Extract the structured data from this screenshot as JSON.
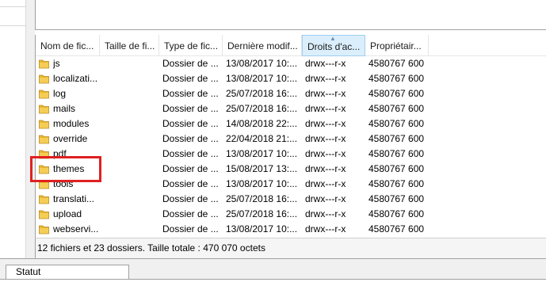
{
  "columns": [
    {
      "key": "name",
      "label": "Nom de fic..."
    },
    {
      "key": "size",
      "label": "Taille de fi..."
    },
    {
      "key": "type",
      "label": "Type de fic..."
    },
    {
      "key": "modified",
      "label": "Dernière modif..."
    },
    {
      "key": "perms",
      "label": "Droits d'ac..."
    },
    {
      "key": "owner",
      "label": "Propriétair..."
    }
  ],
  "rows": [
    {
      "name": "js",
      "type": "Dossier de ...",
      "modified": "13/08/2017 10:...",
      "perms": "drwx---r-x",
      "owner": "4580767 600"
    },
    {
      "name": "localizati...",
      "type": "Dossier de ...",
      "modified": "13/08/2017 10:...",
      "perms": "drwx---r-x",
      "owner": "4580767 600"
    },
    {
      "name": "log",
      "type": "Dossier de ...",
      "modified": "25/07/2018 16:...",
      "perms": "drwx---r-x",
      "owner": "4580767 600"
    },
    {
      "name": "mails",
      "type": "Dossier de ...",
      "modified": "25/07/2018 16:...",
      "perms": "drwx---r-x",
      "owner": "4580767 600"
    },
    {
      "name": "modules",
      "type": "Dossier de ...",
      "modified": "14/08/2018 22:...",
      "perms": "drwx---r-x",
      "owner": "4580767 600"
    },
    {
      "name": "override",
      "type": "Dossier de ...",
      "modified": "22/04/2018 21:...",
      "perms": "drwx---r-x",
      "owner": "4580767 600"
    },
    {
      "name": "pdf",
      "type": "Dossier de ...",
      "modified": "13/08/2017 10:...",
      "perms": "drwx---r-x",
      "owner": "4580767 600"
    },
    {
      "name": "themes",
      "type": "Dossier de ...",
      "modified": "15/08/2017 13:...",
      "perms": "drwx---r-x",
      "owner": "4580767 600"
    },
    {
      "name": "tools",
      "type": "Dossier de ...",
      "modified": "13/08/2017 10:...",
      "perms": "drwx---r-x",
      "owner": "4580767 600"
    },
    {
      "name": "translati...",
      "type": "Dossier de ...",
      "modified": "25/07/2018 16:...",
      "perms": "drwx---r-x",
      "owner": "4580767 600"
    },
    {
      "name": "upload",
      "type": "Dossier de ...",
      "modified": "25/07/2018 16:...",
      "perms": "drwx---r-x",
      "owner": "4580767 600"
    },
    {
      "name": "webservi...",
      "type": "Dossier de ...",
      "modified": "13/08/2017 10:...",
      "perms": "drwx---r-x",
      "owner": "4580767 600"
    }
  ],
  "list_status": "12 fichiers et 23 dossiers. Taille totale : 470 070 octets",
  "bottom_tab": "Statut",
  "icons": {
    "folder": "folder-icon",
    "sort": "sort-ascending-icon"
  },
  "colors": {
    "folder": "#e8b830",
    "highlight": "#e02020",
    "sorted_header": "#dbeefb"
  }
}
